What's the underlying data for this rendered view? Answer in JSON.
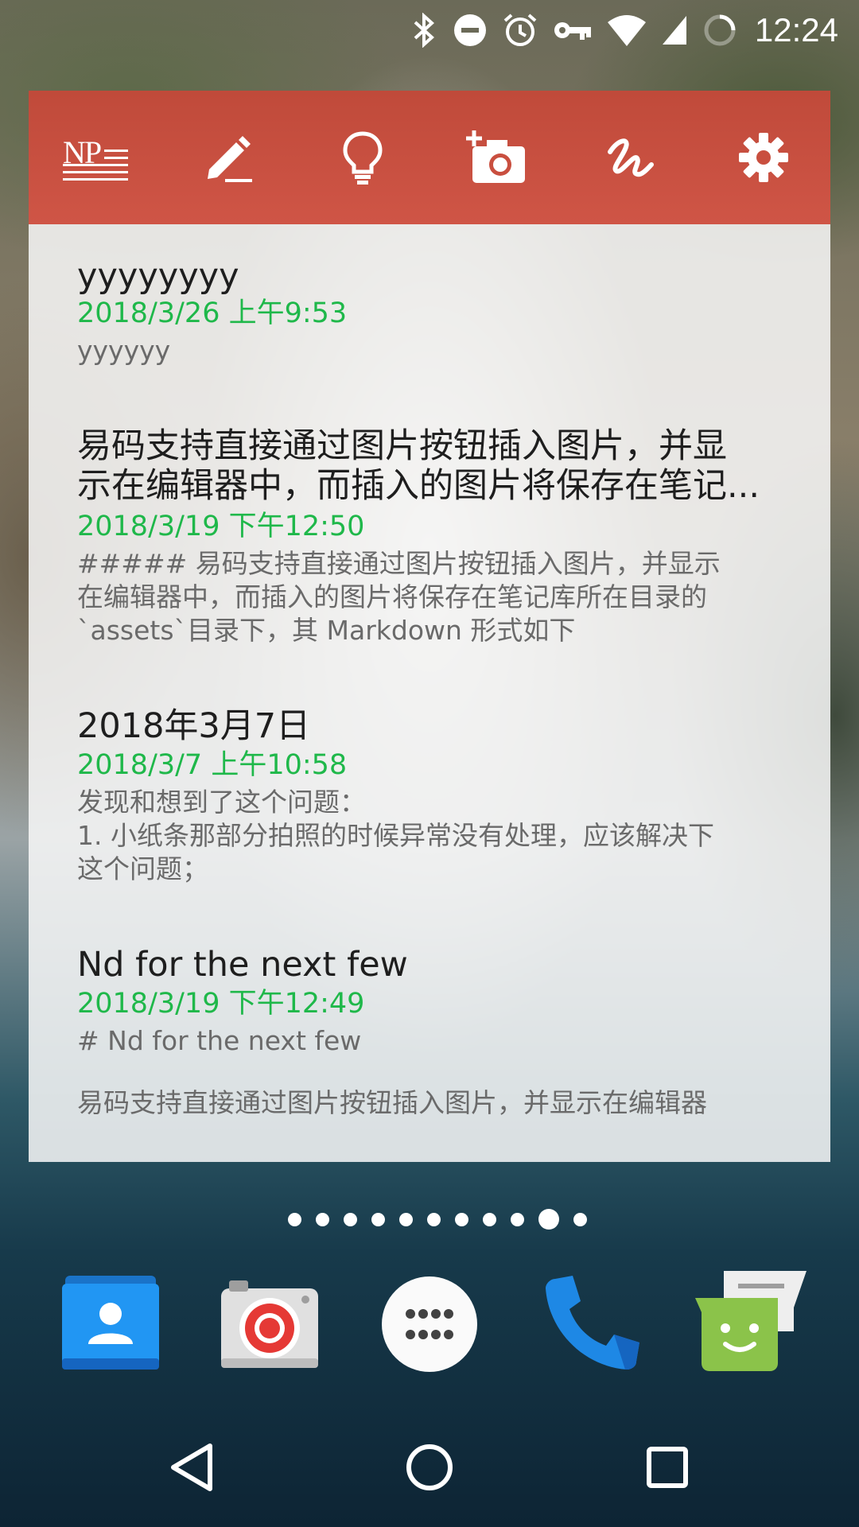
{
  "status_bar": {
    "time": "12:24",
    "icons": [
      "bluetooth-icon",
      "do-not-disturb-icon",
      "alarm-icon",
      "vpn-key-icon",
      "wifi-icon",
      "cellular-signal-icon",
      "battery-charging-icon"
    ]
  },
  "widget": {
    "toolbar": {
      "logo_text": "NP",
      "icons": [
        "app-logo-icon",
        "edit-note-icon",
        "lightbulb-icon",
        "add-photo-icon",
        "handwriting-icon",
        "settings-icon"
      ],
      "color": "#c94f3f"
    },
    "notes": [
      {
        "title": "yyyyyyyy",
        "date": "2018/3/26 上午9:53",
        "body": "yyyyyy"
      },
      {
        "title_line1": "易码支持直接通过图片按钮插入图片，并显",
        "title_line2": "示在编辑器中，而插入的图片将保存在笔记...",
        "date": "2018/3/19 下午12:50",
        "body_line1": "##### 易码支持直接通过图片按钮插入图片，并显示",
        "body_line2": "在编辑器中，而插入的图片将保存在笔记库所在目录的",
        "body_line3": "`assets`目录下，其 Markdown 形式如下"
      },
      {
        "title": "2018年3月7日",
        "date": "2018/3/7 上午10:58",
        "body_line1": "发现和想到了这个问题：",
        "body_line2": "1. 小纸条那部分拍照的时候异常没有处理，应该解决下",
        "body_line3": "这个问题；"
      },
      {
        "title": "Nd for the next few",
        "date": "2018/3/19 下午12:49",
        "body_line1": "# Nd for the next few",
        "body_line2": "易码支持直接通过图片按钮插入图片，并显示在编辑器"
      }
    ],
    "date_color": "#1fb84a"
  },
  "home": {
    "page_count": 11,
    "active_page": 10,
    "dock": [
      "contacts-app-icon",
      "camera-app-icon",
      "app-drawer-icon",
      "phone-app-icon",
      "messaging-app-icon"
    ]
  },
  "nav_bar": {
    "buttons": [
      "back-icon",
      "home-icon",
      "recents-icon"
    ]
  }
}
